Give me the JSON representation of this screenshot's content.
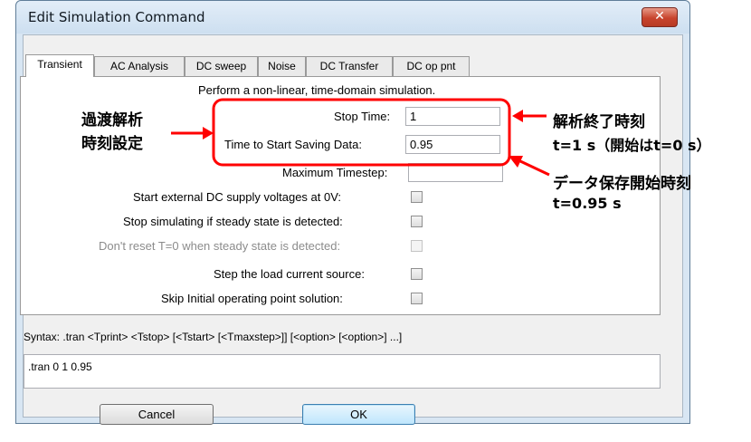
{
  "window": {
    "title": "Edit Simulation Command",
    "close_glyph": "✕"
  },
  "tabs": [
    "Transient",
    "AC Analysis",
    "DC sweep",
    "Noise",
    "DC Transfer",
    "DC op pnt"
  ],
  "panel": {
    "description": "Perform a non-linear, time-domain simulation.",
    "fields": [
      {
        "label": "Stop Time:",
        "value": "1"
      },
      {
        "label": "Time to Start Saving Data:",
        "value": "0.95"
      },
      {
        "label": "Maximum Timestep:",
        "value": ""
      }
    ],
    "options": [
      {
        "label": "Start external DC supply voltages at 0V:",
        "checked": false,
        "enabled": true
      },
      {
        "label": "Stop simulating if steady state is detected:",
        "checked": false,
        "enabled": true
      },
      {
        "label": "Don't reset T=0 when steady state is detected:",
        "checked": false,
        "enabled": false
      },
      {
        "label": "Step the load current source:",
        "checked": false,
        "enabled": true
      },
      {
        "label": "Skip Initial operating point solution:",
        "checked": false,
        "enabled": true
      }
    ]
  },
  "syntax": "Syntax:  .tran <Tprint> <Tstop> [<Tstart> [<Tmaxstep>]] [<option> [<option>] ...]",
  "command": ".tran 0 1 0.95",
  "buttons": {
    "cancel": "Cancel",
    "ok": "OK"
  },
  "annotations": {
    "left_line1": "過渡解析",
    "left_line2": "時刻設定",
    "right_top_line1": "解析終了時刻",
    "right_top_line2": "t=1 s（開始はt=0 s）",
    "right_bottom_line1": "データ保存開始時刻",
    "right_bottom_line2": "t=0.95 s",
    "accent_color": "#ff0000"
  }
}
